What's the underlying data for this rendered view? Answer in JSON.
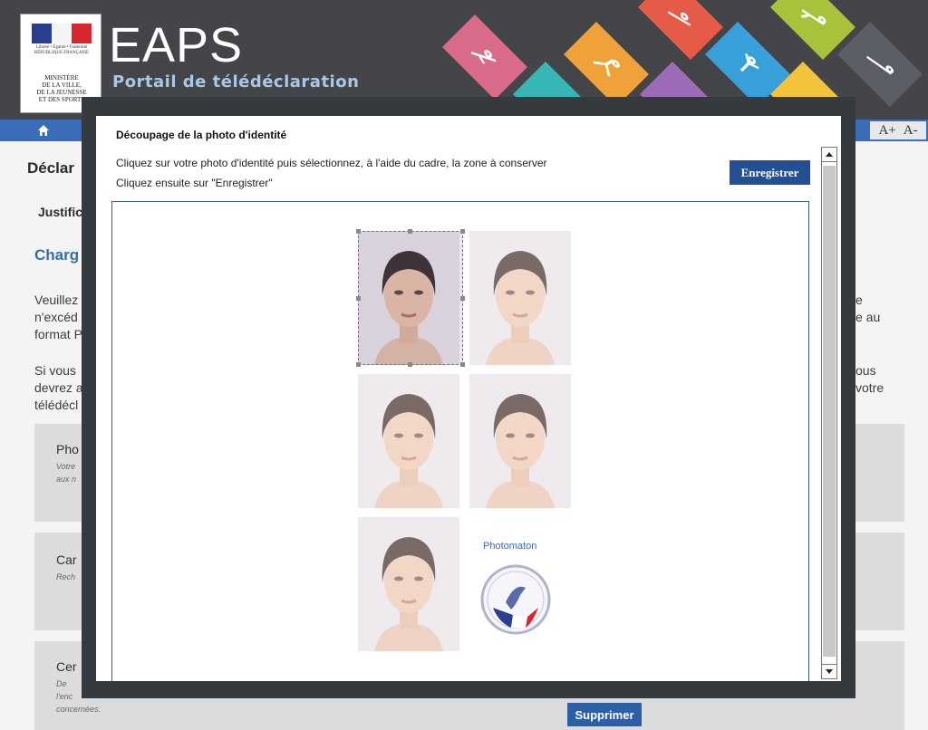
{
  "header": {
    "logo": {
      "republic": "Liberté • Égalité • Fraternité RÉPUBLIQUE FRANÇAISE",
      "ministry_lines": [
        "MINISTÈRE",
        "DE LA VILLE,",
        "DE LA JEUNESSE",
        "ET DES SPORTS"
      ]
    },
    "app_title": "EAPS",
    "app_subtitle": "Portail de télédéclaration",
    "sport_tiles": [
      "pink",
      "orange",
      "red",
      "green",
      "teal",
      "blue",
      "purple",
      "yellow",
      "dark"
    ]
  },
  "toolbar": {
    "home_icon": "home-icon",
    "font_increase": "A+",
    "font_decrease": "A-"
  },
  "background_page": {
    "heading": "Déclar",
    "section": "Justific",
    "subheading": "Charg",
    "para1_lines": [
      "Veuillez",
      "n'excéd",
      "format P"
    ],
    "para1_right": [
      "e",
      "e au"
    ],
    "para2_lines": [
      "Si vous",
      "devrez a",
      "télédécl"
    ],
    "para2_right": [
      "ous",
      "votre"
    ],
    "boxes": [
      {
        "title": "Pho",
        "sub": [
          "Votre",
          "aux n"
        ]
      },
      {
        "title": "Car",
        "sub": [
          "Rech"
        ]
      },
      {
        "title": "Cer",
        "sub": [
          "De",
          "l'enc",
          "concernées."
        ]
      }
    ],
    "delete_button": "Supprimer"
  },
  "modal": {
    "title": "Découpage de la photo d'identité",
    "instruction_1": "Cliquez sur votre photo d'identité puis sélectionnez, à l'aide du cadre, la zone à conserver",
    "instruction_2": "Cliquez ensuite sur \"Enregistrer\"",
    "save_button": "Enregistrer",
    "photo_strip": {
      "photo_count": 5,
      "selected_photo": 1,
      "brand": "Photomaton",
      "stamp_icon": "official-stamp-icon"
    }
  },
  "colors": {
    "header_bg": "#444548",
    "navbar": "#3a6cb8",
    "button_primary": "#234f93",
    "subtitle": "#a9c7e6",
    "link": "#2f6fb0"
  }
}
